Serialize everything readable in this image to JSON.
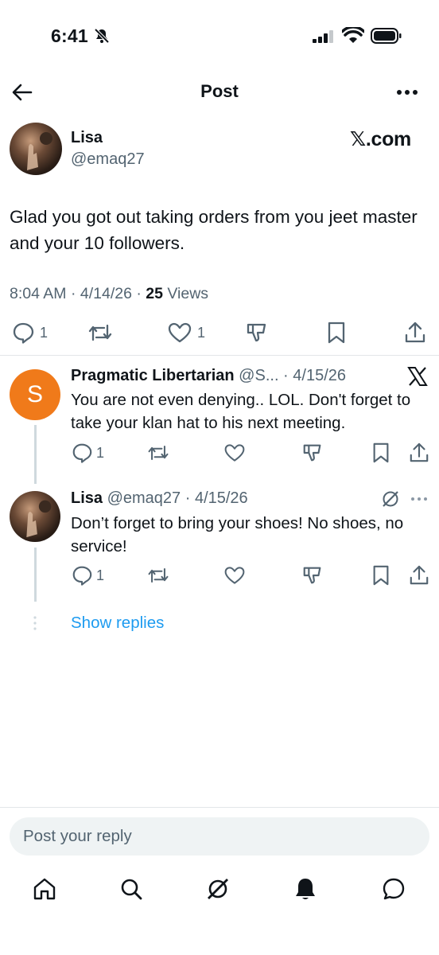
{
  "status_bar": {
    "time": "6:41"
  },
  "header": {
    "title": "Post"
  },
  "tweet": {
    "author_name": "Lisa",
    "author_handle": "@emaq27",
    "brand": "𝕏.com",
    "text": "Glad you got out taking orders from you jeet master and your 10 followers.",
    "timestamp": "8:04 AM · 4/14/26 · ",
    "views_count": "25",
    "views_label": " Views",
    "replies_count": "1",
    "likes_count": "1"
  },
  "replies": [
    {
      "avatar_letter": "S",
      "name": "Pragmatic Libertarian",
      "handle_date": " @S... · 4/15/26",
      "text": "You are not even denying.. LOL. Don't forget to take your klan hat to his next meeting.",
      "replies_count": "1"
    },
    {
      "name": "Lisa",
      "handle_date": " @emaq27 · 4/15/26",
      "text": "Don’t forget to bring your shoes! No shoes, no service!",
      "replies_count": "1"
    }
  ],
  "show_replies": "Show replies",
  "compose": {
    "placeholder": "Post your reply"
  },
  "icons": [
    "back-arrow-icon",
    "more-icon",
    "reply-icon",
    "repost-icon",
    "like-icon",
    "dislike-icon",
    "bookmark-icon",
    "share-icon",
    "home-icon",
    "search-icon",
    "grok-icon",
    "notifications-icon",
    "messages-icon"
  ],
  "colors": {
    "accent": "#1d9bf0",
    "avatar_orange": "#f07a1a",
    "muted": "#536471"
  }
}
